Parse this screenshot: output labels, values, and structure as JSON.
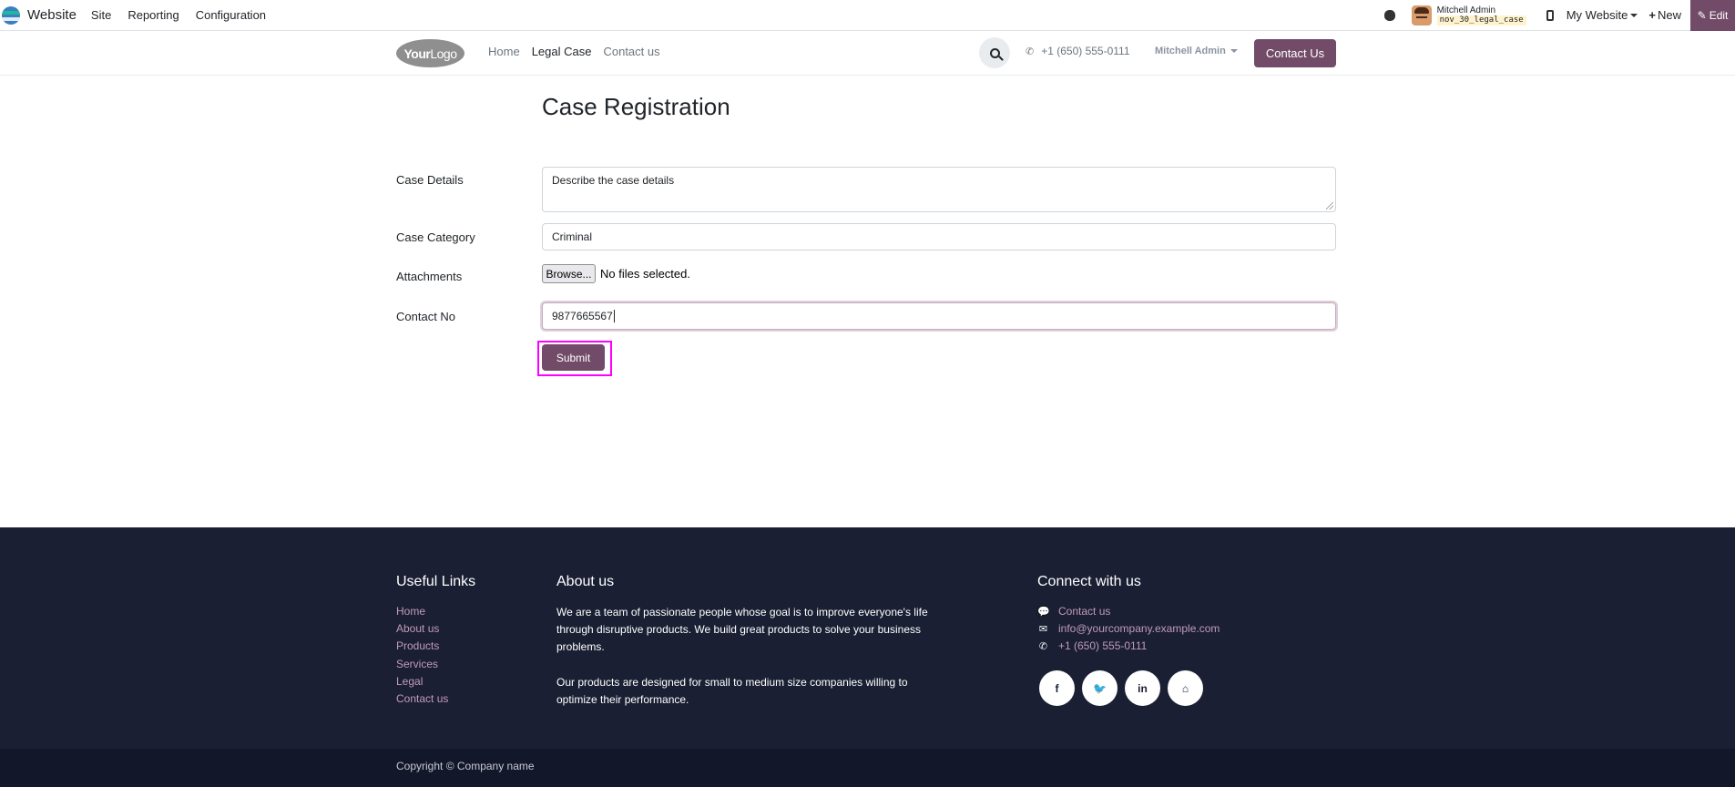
{
  "adminbar": {
    "brand": "Website",
    "menu": [
      "Site",
      "Reporting",
      "Configuration"
    ],
    "user_name": "Mitchell Admin",
    "database": "nov_30_legal_case",
    "my_website": "My Website",
    "new_label": "New",
    "edit_label": "Edit"
  },
  "header": {
    "logo_bold": "Your",
    "logo_thin": "Logo",
    "nav": [
      "Home",
      "Legal Case",
      "Contact us"
    ],
    "active_nav": "Legal Case",
    "phone": "+1 (650) 555-0111",
    "user": "Mitchell Admin",
    "contact_button": "Contact Us"
  },
  "form": {
    "title": "Case Registration",
    "case_details_label": "Case Details",
    "case_details_placeholder": "Describe the case details",
    "case_category_label": "Case Category",
    "case_category_value": "Criminal",
    "attachments_label": "Attachments",
    "browse_label": "Browse...",
    "no_files": "No files selected.",
    "contact_no_label": "Contact No",
    "contact_no_value": "9877665567",
    "submit_label": "Submit"
  },
  "footer": {
    "useful_links_title": "Useful Links",
    "useful_links": [
      "Home",
      "About us",
      "Products",
      "Services",
      "Legal",
      "Contact us"
    ],
    "about_title": "About us",
    "about_p1": "We are a team of passionate people whose goal is to improve everyone's life through disruptive products. We build great products to solve your business problems.",
    "about_p2": "Our products are designed for small to medium size companies willing to optimize their performance.",
    "connect_title": "Connect with us",
    "contact_us": "Contact us",
    "email": "info@yourcompany.example.com",
    "phone": "+1 (650) 555-0111",
    "social_icons": [
      "facebook-icon",
      "twitter-icon",
      "linkedin-icon",
      "home-icon"
    ],
    "copyright": "Copyright © Company name"
  },
  "colors": {
    "primary": "#714b67",
    "footer_bg": "#1a1f33",
    "link": "#c19bb8",
    "highlight": "#ff00ff"
  }
}
